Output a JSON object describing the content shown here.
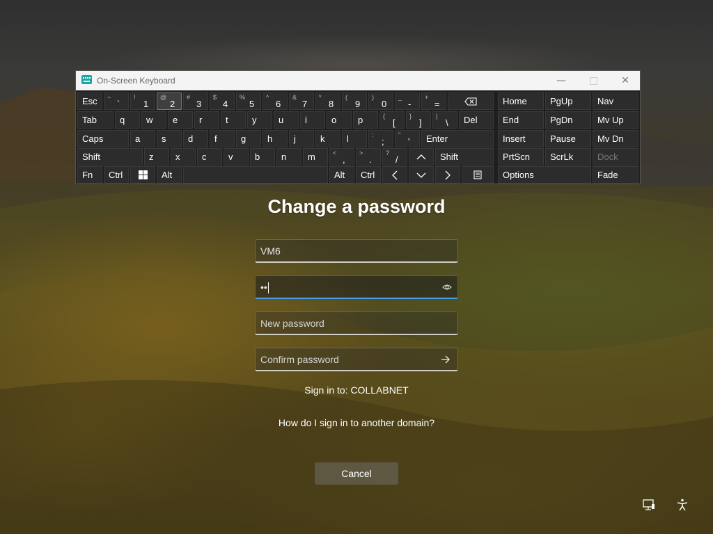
{
  "osk": {
    "title": "On-Screen Keyboard",
    "rows": [
      [
        {
          "id": "esc",
          "label": "Esc"
        },
        {
          "id": "tilde",
          "shift": "~",
          "label": "`"
        },
        {
          "id": "1",
          "shift": "!",
          "label": "1"
        },
        {
          "id": "2",
          "shift": "@",
          "label": "2",
          "active": true
        },
        {
          "id": "3",
          "shift": "#",
          "label": "3"
        },
        {
          "id": "4",
          "shift": "$",
          "label": "4"
        },
        {
          "id": "5",
          "shift": "%",
          "label": "5"
        },
        {
          "id": "6",
          "shift": "^",
          "label": "6"
        },
        {
          "id": "7",
          "shift": "&",
          "label": "7"
        },
        {
          "id": "8",
          "shift": "*",
          "label": "8"
        },
        {
          "id": "9",
          "shift": "(",
          "label": "9"
        },
        {
          "id": "0",
          "shift": ")",
          "label": "0"
        },
        {
          "id": "minus",
          "shift": "_",
          "label": "-"
        },
        {
          "id": "equals",
          "shift": "+",
          "label": "="
        },
        {
          "id": "backspace",
          "icon": "backspace-icon"
        }
      ],
      [
        {
          "id": "tab",
          "label": "Tab"
        },
        {
          "id": "q",
          "label": "q"
        },
        {
          "id": "w",
          "label": "w"
        },
        {
          "id": "e",
          "label": "e"
        },
        {
          "id": "r",
          "label": "r"
        },
        {
          "id": "t",
          "label": "t"
        },
        {
          "id": "y",
          "label": "y"
        },
        {
          "id": "u",
          "label": "u"
        },
        {
          "id": "i",
          "label": "i"
        },
        {
          "id": "o",
          "label": "o"
        },
        {
          "id": "p",
          "label": "p"
        },
        {
          "id": "lbracket",
          "shift": "{",
          "label": "["
        },
        {
          "id": "rbracket",
          "shift": "}",
          "label": "]"
        },
        {
          "id": "backslash",
          "shift": "|",
          "label": "\\"
        },
        {
          "id": "del",
          "label": "Del"
        }
      ],
      [
        {
          "id": "caps",
          "label": "Caps"
        },
        {
          "id": "a",
          "label": "a"
        },
        {
          "id": "s",
          "label": "s"
        },
        {
          "id": "d",
          "label": "d"
        },
        {
          "id": "f",
          "label": "f"
        },
        {
          "id": "g",
          "label": "g"
        },
        {
          "id": "h",
          "label": "h"
        },
        {
          "id": "j",
          "label": "j"
        },
        {
          "id": "k",
          "label": "k"
        },
        {
          "id": "l",
          "label": "l"
        },
        {
          "id": "semicolon",
          "shift": ":",
          "label": ";"
        },
        {
          "id": "quote",
          "shift": "\"",
          "label": "'"
        },
        {
          "id": "enter",
          "label": "Enter"
        }
      ],
      [
        {
          "id": "lshift",
          "label": "Shift"
        },
        {
          "id": "z",
          "label": "z"
        },
        {
          "id": "x",
          "label": "x"
        },
        {
          "id": "c",
          "label": "c"
        },
        {
          "id": "v",
          "label": "v"
        },
        {
          "id": "b",
          "label": "b"
        },
        {
          "id": "n",
          "label": "n"
        },
        {
          "id": "m",
          "label": "m"
        },
        {
          "id": "comma",
          "shift": "<",
          "label": ","
        },
        {
          "id": "period",
          "shift": ">",
          "label": "."
        },
        {
          "id": "slash",
          "shift": "?",
          "label": "/"
        },
        {
          "id": "up",
          "icon": "chevron-up-icon"
        },
        {
          "id": "rshift",
          "label": "Shift"
        }
      ],
      [
        {
          "id": "fn",
          "label": "Fn"
        },
        {
          "id": "lctrl",
          "label": "Ctrl"
        },
        {
          "id": "win",
          "icon": "windows-icon"
        },
        {
          "id": "lalt",
          "label": "Alt"
        },
        {
          "id": "space",
          "label": ""
        },
        {
          "id": "ralt",
          "label": "Alt"
        },
        {
          "id": "rctrl",
          "label": "Ctrl"
        },
        {
          "id": "left",
          "icon": "chevron-left-icon"
        },
        {
          "id": "down",
          "icon": "chevron-down-icon"
        },
        {
          "id": "right",
          "icon": "chevron-right-icon"
        },
        {
          "id": "menu",
          "icon": "context-menu-icon"
        }
      ]
    ],
    "nav_keys": [
      [
        {
          "id": "home",
          "label": "Home"
        },
        {
          "id": "pgup",
          "label": "PgUp"
        },
        {
          "id": "nav",
          "label": "Nav"
        }
      ],
      [
        {
          "id": "end",
          "label": "End"
        },
        {
          "id": "pgdn",
          "label": "PgDn"
        },
        {
          "id": "mvup",
          "label": "Mv Up"
        }
      ],
      [
        {
          "id": "insert",
          "label": "Insert"
        },
        {
          "id": "pause",
          "label": "Pause"
        },
        {
          "id": "mvdn",
          "label": "Mv Dn"
        }
      ],
      [
        {
          "id": "prtscn",
          "label": "PrtScn"
        },
        {
          "id": "scrlk",
          "label": "ScrLk"
        },
        {
          "id": "dock",
          "label": "Dock",
          "muted": true
        }
      ],
      [
        {
          "id": "options",
          "label": "Options"
        },
        {
          "id": "fade",
          "label": "Fade"
        }
      ]
    ]
  },
  "form": {
    "title": "Change a password",
    "username_value": "VM6",
    "old_password_value": "••",
    "new_password_placeholder": "New password",
    "confirm_password_placeholder": "Confirm password",
    "sign_in_to": "Sign in to: COLLABNET",
    "other_domain_link": "How do I sign in to another domain?",
    "cancel_label": "Cancel"
  },
  "icons": {
    "reveal_password": "eye-icon",
    "submit": "arrow-right-icon",
    "network": "network-icon",
    "accessibility": "accessibility-icon"
  },
  "colors": {
    "focus_accent": "#4a9de8",
    "osk_background": "#1f1f1f",
    "osk_key": "#2c2c2c"
  }
}
